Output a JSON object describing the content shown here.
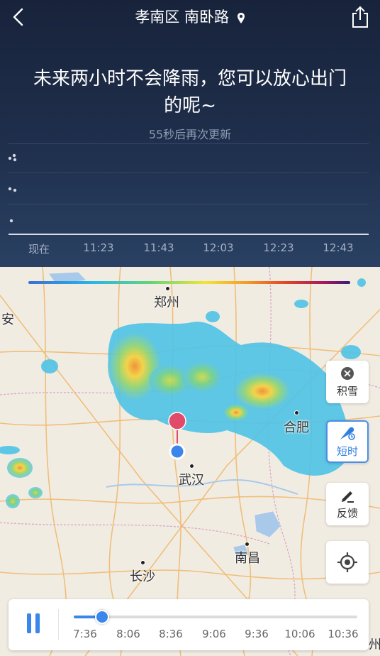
{
  "header": {
    "location": "孝南区 南卧路",
    "back_icon": "back-chevron-icon",
    "share_icon": "share-icon"
  },
  "forecast": {
    "headline": "未来两小时不会降雨，您可以放心出门的呢~",
    "update_note": "55秒后再次更新",
    "time_ticks": [
      "现在",
      "11:23",
      "11:43",
      "12:03",
      "12:23",
      "12:43"
    ]
  },
  "map": {
    "cities": [
      "郑州",
      "合肥",
      "武汉",
      "南昌",
      "长沙"
    ],
    "edge_labels": {
      "left": "安",
      "right": "州"
    }
  },
  "side_buttons": [
    {
      "label": "积雪",
      "icon": "snow-icon",
      "active": false
    },
    {
      "label": "短时",
      "icon": "short-term-icon",
      "active": true
    },
    {
      "label": "反馈",
      "icon": "feedback-edit-icon",
      "active": false
    },
    {
      "label": "",
      "icon": "locate-icon",
      "active": false
    }
  ],
  "player": {
    "times": [
      "7:36",
      "8:06",
      "8:36",
      "9:06",
      "9:36",
      "10:06",
      "10:36"
    ],
    "progress": 0.1,
    "state_icon": "pause-icon"
  },
  "colors": {
    "accent": "#3a86ea",
    "panel_bg": "#1f2f4c"
  }
}
